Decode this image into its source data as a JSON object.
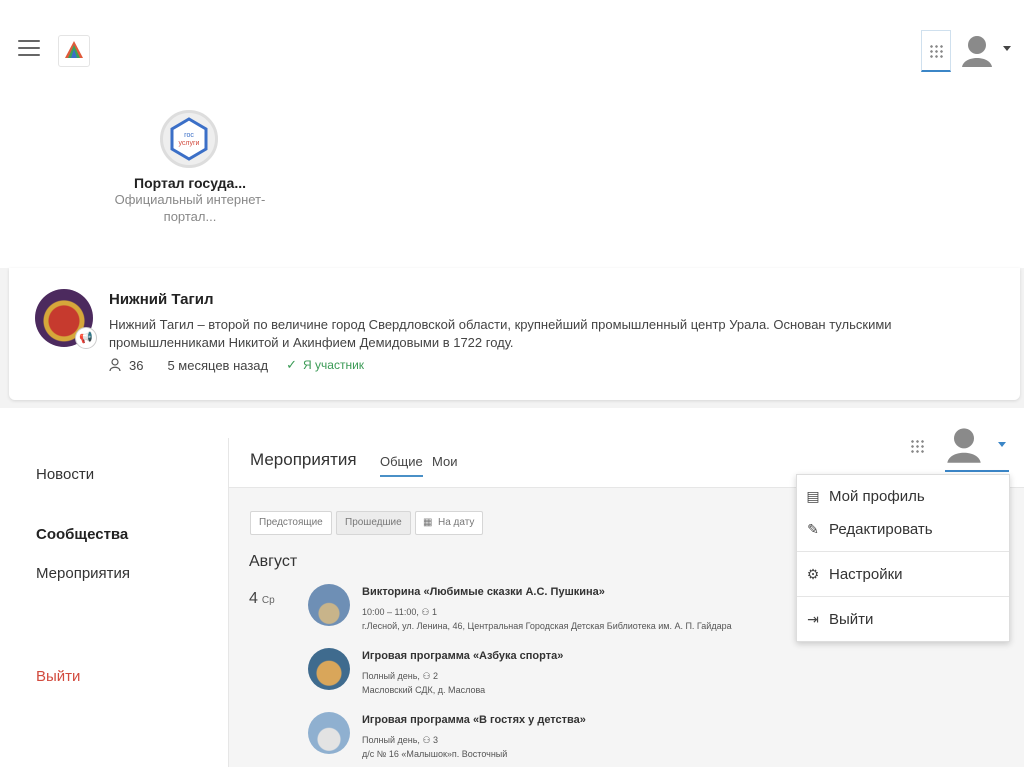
{
  "portal": {
    "title": "Портал госуда...",
    "description": "Официальный интернет-портал...",
    "logo_text": "гос услуги"
  },
  "community": {
    "title": "Нижний Тагил",
    "description": "Нижний Тагил – второй по величине город Свердловской области, крупнейший промышленный центр Урала. Основан тульскими промышленниками Никитой и Акинфием Демидовыми в 1722 году.",
    "members": "36",
    "age": "5 месяцев назад",
    "membership": "Я участник"
  },
  "sidebar": {
    "items": [
      {
        "label": "Новости"
      },
      {
        "label": "Сообщества"
      },
      {
        "label": "Мероприятия"
      },
      {
        "label": "Выйти"
      }
    ]
  },
  "events": {
    "title": "Мероприятия",
    "tabs": [
      {
        "label": "Общие"
      },
      {
        "label": "Мои"
      }
    ],
    "filters": [
      {
        "label": "Предстоящие"
      },
      {
        "label": "Прошедшие"
      },
      {
        "label": "На дату"
      }
    ],
    "month": "Август",
    "day": "4",
    "weekday": "Ср",
    "items": [
      {
        "title": "Викторина «Любимые сказки А.С. Пушкина»",
        "time": "10:00 – 11:00,",
        "count": "1",
        "place": "г.Лесной, ул. Ленина, 46, Центральная Городская Детская Библиотека им. А. П. Гайдара"
      },
      {
        "title": "Игровая программа «Азбука спорта»",
        "time": "Полный день,",
        "count": "2",
        "place": "Масловский СДК, д. Маслова"
      },
      {
        "title": "Игровая программа «В гостях у детства»",
        "time": "Полный день,",
        "count": "3",
        "place": "д/с № 16 «Малышок»п. Восточный"
      }
    ]
  },
  "menu": {
    "items": [
      {
        "label": "Мой профиль"
      },
      {
        "label": "Редактировать"
      },
      {
        "label": "Настройки"
      },
      {
        "label": "Выйти"
      }
    ]
  },
  "colors": {
    "accent": "#3b86c7",
    "exit": "#d24b3e",
    "member": "#3a9a55"
  }
}
